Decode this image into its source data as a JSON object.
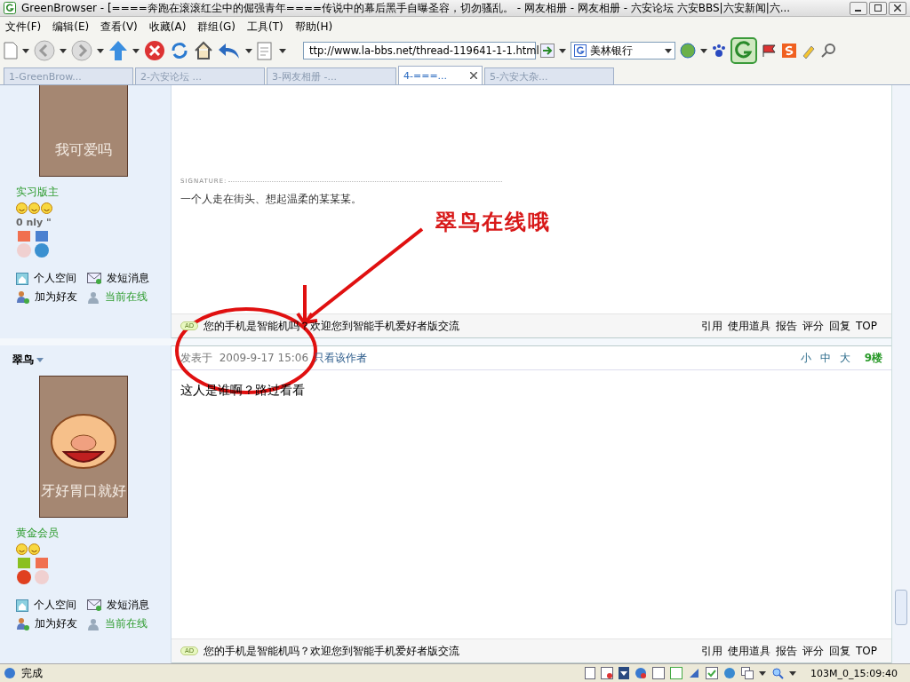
{
  "window": {
    "title": "GreenBrowser - [====奔跑在滚滚红尘中的倔强青年====传说中的幕后黑手自曝圣容，切勿骚乱。 - 网友相册 - 网友相册 - 六安论坛 六安BBS|六安新闻|六..."
  },
  "menu": [
    "文件(F)",
    "编辑(E)",
    "查看(V)",
    "收藏(A)",
    "群组(G)",
    "工具(T)",
    "帮助(H)"
  ],
  "address": {
    "value": "ttp://www.la-bbs.net/thread-119641-1-1.html"
  },
  "search": {
    "value": "美林银行"
  },
  "tabs": [
    {
      "label": "1-GreenBrow...",
      "selected": false
    },
    {
      "label": "2-六安论坛 ...",
      "selected": false
    },
    {
      "label": "3-网友相册 -...",
      "selected": false
    },
    {
      "label": "4-===...",
      "selected": true
    },
    {
      "label": "5-六安大杂...",
      "selected": false
    }
  ],
  "posts": [
    {
      "avatar_caption": "我可爱吗",
      "rank": "实习版主",
      "custom_title": "0 nly \"",
      "links": [
        "个人空间",
        "发短消息",
        "加为好友",
        "当前在线"
      ],
      "signature_label": "SIGNATURE:",
      "body": "一个人走在街头、想起温柔的某某某。",
      "ad_badge": "AD",
      "ad_text": "您的手机是智能机吗？欢迎您到智能手机爱好者版交流",
      "actions": [
        "引用",
        "使用道具",
        "报告",
        "评分",
        "回复",
        "TOP"
      ]
    },
    {
      "author": "翠鸟",
      "avatar_caption": "牙好胃口就好",
      "rank": "黄金会员",
      "links": [
        "个人空间",
        "发短消息",
        "加为好友",
        "当前在线"
      ],
      "header": {
        "posted_label": "发表于",
        "date": "2009-9-17 15:06",
        "author_only": "只看该作者",
        "sizes": [
          "小",
          "中",
          "大"
        ],
        "floor": "9楼"
      },
      "body": "这人是谁啊？路过看看",
      "ad_badge": "AD",
      "ad_text": "您的手机是智能机吗？欢迎您到智能手机爱好者版交流",
      "actions": [
        "引用",
        "使用道具",
        "报告",
        "评分",
        "回复",
        "TOP"
      ]
    }
  ],
  "annotation": {
    "text": "翠鸟在线哦"
  },
  "status_bar": {
    "text": "完成",
    "clock": "103M_0_15:09:40"
  }
}
